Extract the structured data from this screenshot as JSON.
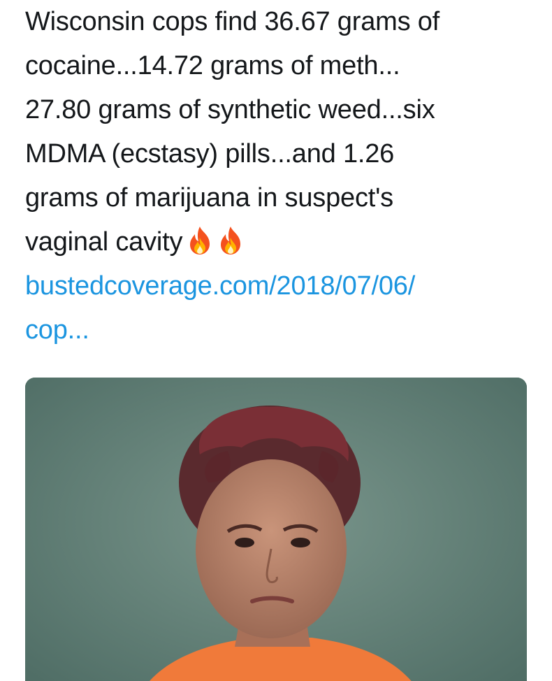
{
  "tweet": {
    "lines": [
      "Wisconsin cops find 36.67 grams of",
      "cocaine...14.72 grams of meth...",
      "27.80 grams of synthetic weed...six",
      "MDMA (ecstasy) pills...and 1.26",
      "grams of marijuana in suspect's",
      "vaginal cavity"
    ],
    "emojis": [
      "fire-emoji",
      "fire-emoji"
    ],
    "link_lines": [
      "bustedcoverage.com/2018/07/06/",
      "cop..."
    ]
  },
  "media": {
    "type": "mugshot-photo",
    "background_color": "#5e7d74",
    "shirt_color": "#f07a3a"
  },
  "colors": {
    "text": "#14171a",
    "link": "#1b95e0"
  }
}
